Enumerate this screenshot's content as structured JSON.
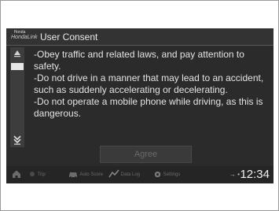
{
  "header": {
    "logo_top": "Honda",
    "logo_main": "HondaLink",
    "title": "User Consent"
  },
  "content": {
    "paragraphs": [
      "-Obey traffic and related laws, and pay attention to safety.",
      "-Do not drive in a manner that may lead to an accident, such as suddenly accelerating or decelerating.",
      "-Do not operate a mobile phone while driving, as this is dangerous."
    ]
  },
  "agree_label": "Agree",
  "bottom_bar": {
    "items": [
      {
        "label": "",
        "icon": "home-icon"
      },
      {
        "label": "Trip",
        "icon": "trip-icon"
      },
      {
        "label": "Auto Score",
        "icon": "car-icon"
      },
      {
        "label": "Data Log",
        "icon": "datalog-icon"
      },
      {
        "label": "Settings",
        "icon": "gear-icon"
      }
    ],
    "signal": "→ •",
    "clock": "12:34"
  },
  "colors": {
    "screen_bg": "#2b2b2b",
    "text": "#e4e4e4",
    "disabled": "#6a6a6a"
  }
}
